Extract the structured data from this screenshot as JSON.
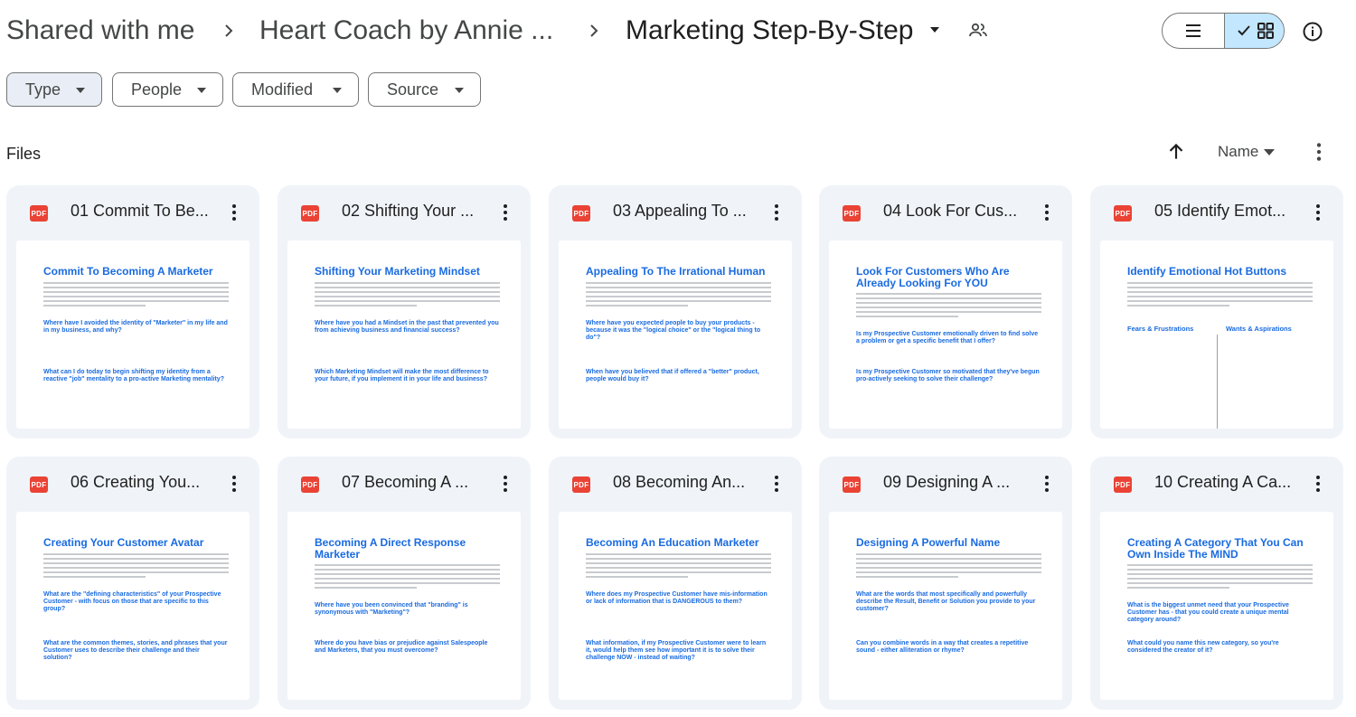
{
  "breadcrumb": {
    "items": [
      "Shared with me",
      "Heart Coach by Annie ...",
      "Marketing Step-By-Step"
    ]
  },
  "filters": [
    "Type",
    "People",
    "Modified",
    "Source"
  ],
  "files_section": {
    "label": "Files",
    "sort_label": "Name"
  },
  "accent_colors": {
    "selected_view": "#c2e7ff",
    "pdf_red": "#ea4335",
    "doc_blue": "#1a6be0"
  },
  "files": [
    {
      "name": "01 Commit To Be...",
      "badge": "PDF",
      "preview": {
        "heading": "Commit To Becoming A Marketer",
        "questions": [
          "Where have I avoided the identity of \"Marketer\" in my life and in my business, and why?",
          "What can I do today to begin shifting my identity from a reactive \"job\" mentality to a pro-active Marketing mentality?"
        ]
      }
    },
    {
      "name": "02 Shifting Your ...",
      "badge": "PDF",
      "preview": {
        "heading": "Shifting Your Marketing Mindset",
        "questions": [
          "Where have you had a Mindset in the past that prevented you from achieving business and financial success?",
          "Which Marketing Mindset will make the most difference to your future, if you implement it in your life and business?"
        ]
      }
    },
    {
      "name": "03 Appealing To ...",
      "badge": "PDF",
      "preview": {
        "heading": "Appealing To The Irrational Human",
        "questions": [
          "Where have you expected people to buy your products - because it was the \"logical choice\" or the \"logical thing to do\"?",
          "When have you believed that if offered a \"better\" product, people would buy it?"
        ]
      }
    },
    {
      "name": "04 Look For Cus...",
      "badge": "PDF",
      "preview": {
        "heading": "Look For Customers Who Are Already Looking For YOU",
        "questions": [
          "Is my Prospective Customer emotionally driven to find solve a problem or get a specific benefit that I offer?",
          "Is my Prospective Customer so motivated that they've begun pro-actively seeking to solve their challenge?"
        ]
      }
    },
    {
      "name": "05 Identify Emot...",
      "badge": "PDF",
      "preview": {
        "heading": "Identify Emotional Hot Buttons",
        "columns": [
          "Fears & Frustrations",
          "Wants & Aspirations"
        ]
      }
    },
    {
      "name": "06 Creating You...",
      "badge": "PDF",
      "preview": {
        "heading": "Creating Your Customer Avatar",
        "questions": [
          "What are the \"defining characteristics\" of your Prospective Customer - with focus on those that are specific to this group?",
          "What are the common themes, stories, and phrases that your Customer uses to describe their challenge and their solution?"
        ]
      }
    },
    {
      "name": "07 Becoming A ...",
      "badge": "PDF",
      "preview": {
        "heading": "Becoming A Direct Response Marketer",
        "questions": [
          "Where have you been convinced that \"branding\" is synonymous with \"Marketing\"?",
          "Where do you have bias or prejudice against Salespeople and Marketers, that you must overcome?"
        ]
      }
    },
    {
      "name": "08 Becoming An...",
      "badge": "PDF",
      "preview": {
        "heading": "Becoming An Education Marketer",
        "questions": [
          "Where does my Prospective Customer have mis-information or lack of information that is DANGEROUS to them?",
          "What information, if my Prospective Customer were to learn it, would help them see how important it is to solve their challenge NOW - instead of waiting?"
        ]
      }
    },
    {
      "name": "09 Designing A ...",
      "badge": "PDF",
      "preview": {
        "heading": "Designing A Powerful Name",
        "questions": [
          "What are the words that most specifically and powerfully describe the Result, Benefit or Solution you provide to your customer?",
          "Can you combine words in a way that creates a repetitive sound - either alliteration or rhyme?"
        ]
      }
    },
    {
      "name": "10 Creating A Ca...",
      "badge": "PDF",
      "preview": {
        "heading": "Creating A Category That You Can Own Inside The MIND",
        "questions": [
          "What is the biggest unmet need that your Prospective Customer has - that you could create a unique mental category around?",
          "What could you name this new category, so you're considered the creator of it?"
        ]
      }
    }
  ]
}
